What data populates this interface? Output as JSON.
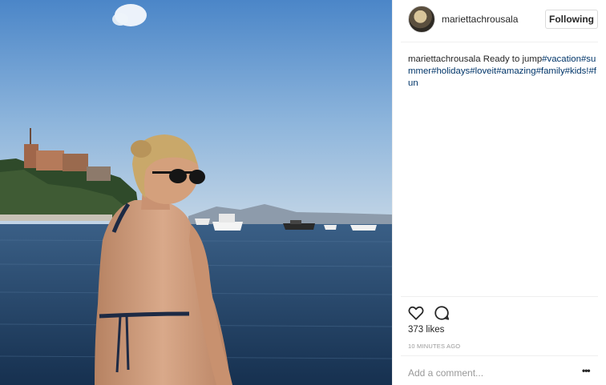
{
  "post": {
    "username": "mariettachrousala",
    "follow_label": "Following",
    "caption_user": "mariettachrousala",
    "caption_text": "Ready to jump",
    "hashtags": [
      "#vacation",
      "#summer",
      "#holidays",
      "#loveit",
      "#amazing",
      "#family",
      "#kids!",
      "#fun"
    ],
    "likes": "373 likes",
    "timestamp": "10 MINUTES AGO",
    "comment_placeholder": "Add a comment...",
    "more_label": "•••"
  },
  "icons": {
    "like": "heart-icon",
    "comment": "comment-bubble-icon",
    "more": "more-options-icon"
  },
  "colors": {
    "hashtag": "#003569",
    "text": "#262626",
    "muted": "#999999",
    "border": "#dbdbdb"
  }
}
